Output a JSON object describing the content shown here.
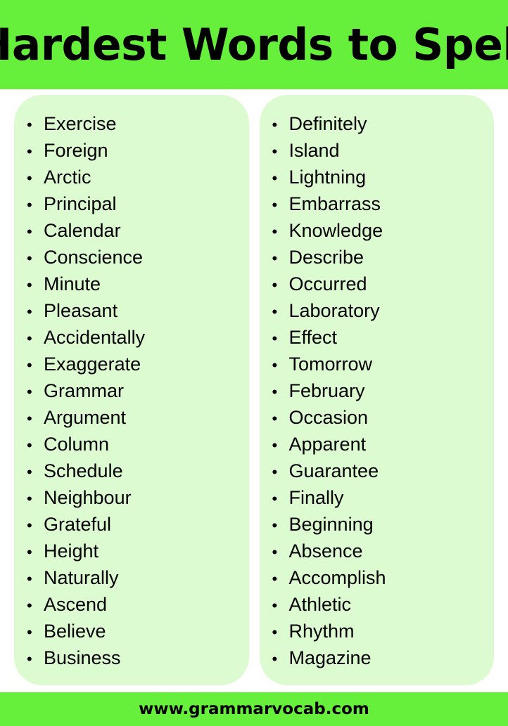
{
  "header": {
    "title": "Hardest Words to Spell",
    "background_color": "#67f03b",
    "text_color": "#000000"
  },
  "columns": [
    {
      "name": "left-column",
      "background_color": "#ddfbd0",
      "bullet_glyph": "•",
      "items": [
        "Exercise",
        "Foreign",
        "Arctic",
        "Principal",
        "Calendar",
        "Conscience",
        "Minute",
        "Pleasant",
        "Accidentally",
        "Exaggerate",
        "Grammar",
        "Argument",
        "Column",
        "Schedule",
        "Neighbour",
        "Grateful",
        "Height",
        "Naturally",
        "Ascend",
        "Believe",
        "Business"
      ]
    },
    {
      "name": "right-column",
      "background_color": "#ddfbd0",
      "bullet_glyph": "•",
      "items": [
        "Definitely",
        "Island",
        "Lightning",
        "Embarrass",
        "Knowledge",
        "Describe",
        "Occurred",
        "Laboratory",
        "Effect",
        "Tomorrow",
        "February",
        "Occasion",
        "Apparent",
        "Guarantee",
        "Finally",
        "Beginning",
        "Absence",
        "Accomplish",
        "Athletic",
        "Rhythm",
        "Magazine"
      ]
    }
  ],
  "footer": {
    "website": "www.grammarvocab.com",
    "background_color": "#67f03b",
    "text_color": "#000000"
  }
}
